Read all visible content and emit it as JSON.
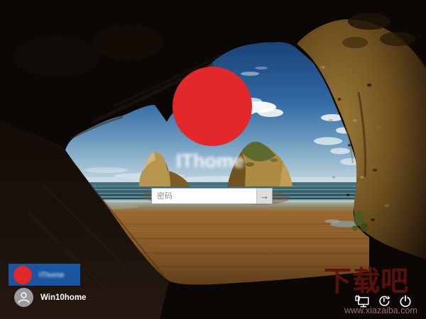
{
  "lock_screen": {
    "center_user": {
      "name": "IThome"
    },
    "password": {
      "placeholder": "密码",
      "value": "",
      "submit_icon": "→"
    },
    "user_list": [
      {
        "name": "IThome",
        "selected": true
      },
      {
        "name": "Win10home",
        "selected": false
      }
    ],
    "tray": {
      "icons": [
        {
          "name": "network-icon"
        },
        {
          "name": "ease-of-access-icon"
        },
        {
          "name": "power-icon"
        }
      ]
    },
    "watermark": {
      "title": "下载吧",
      "url": "www.xiazaiba.com"
    },
    "colors": {
      "censor_red": "#e2282a",
      "selected_tile_blue": "#1955a0",
      "avatar_gray": "#9c9c9c",
      "watermark_red": "#5c120c"
    }
  }
}
